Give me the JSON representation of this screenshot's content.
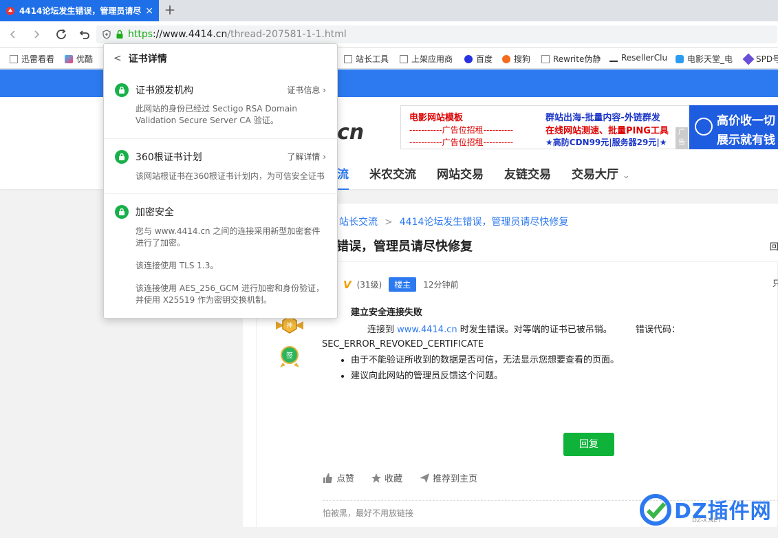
{
  "browser": {
    "tab_title": "4414论坛发生错误，管理员请尽",
    "tab_close": "×",
    "new_tab": "+",
    "url_scheme": "https",
    "url_host": "://www.4414.cn",
    "url_path": "/thread-207581-1-1.html",
    "accent_color": "#1e6fe8"
  },
  "bookmarks": [
    {
      "label": "迅雷看看",
      "icon": "page-icon"
    },
    {
      "label": "优酷",
      "icon": "youku-icon"
    },
    {
      "label": "站长工具",
      "icon": "folder-icon"
    },
    {
      "label": "上架应用商",
      "icon": "folder-icon"
    },
    {
      "label": "百度",
      "icon": "baidu-icon"
    },
    {
      "label": "搜狗",
      "icon": "sogou-icon"
    },
    {
      "label": "Rewrite伪静",
      "icon": "page-icon"
    },
    {
      "label": "ResellerClu",
      "icon": "reseller-icon"
    },
    {
      "label": "电影天堂_电",
      "icon": "shield-icon"
    },
    {
      "label": "SPD号",
      "icon": "spd-icon"
    }
  ],
  "header": {
    "logo_part": "cn",
    "ad_left": {
      "l1": "电影网站模板",
      "l2": "-----------广告位招租----------",
      "l3": "-----------广告位招租----------",
      "r1": "群站出海-批量内容-外链群发",
      "r2": "在线网站测速、批量PING工具",
      "r3": "★高防CDN99元|服务器29元|★"
    },
    "ad_tag": "广告",
    "ad_right": {
      "t1": "高价收一切",
      "t2": "展示就有钱"
    },
    "nav": [
      "流",
      "米农交流",
      "网站交易",
      "友链交易",
      "交易大厅"
    ],
    "nav_dropdown": "⌄"
  },
  "content": {
    "breadcrumb": [
      "站长交流",
      "4414论坛发生错误，管理员请尽快修复"
    ],
    "title": "错误，管理员请尽快修复",
    "title_right": "回",
    "meta": {
      "level_icon": "V",
      "level": "(31级)",
      "badge": "楼主",
      "time": "12分钟前",
      "right": "只"
    },
    "error": {
      "heading": "建立安全连接失败",
      "line_prefix": "连接到",
      "line_host": "www.4414.cn",
      "line_suffix": "时发生错误。对等端的证书已被吊销。",
      "code_label": "错误代码：",
      "code": "SEC_ERROR_REVOKED_CERTIFICATE",
      "bullets": [
        "由于不能验证所收到的数据是否可信，无法显示您想要查看的页面。",
        "建议向此网站的管理员反馈这个问题。"
      ]
    },
    "medal1_text": "神",
    "medal2_text": "签",
    "reply_button": "回复",
    "actions": [
      "点赞",
      "收藏",
      "推荐到主页"
    ],
    "signature": "怕被黑，最好不用放链接"
  },
  "popup": {
    "title": "证书详情",
    "sections": [
      {
        "title": "证书颁发机构",
        "link": "证书信息",
        "desc": "此网站的身份已经过 Sectigo RSA Domain Validation Secure Server CA 验证。"
      },
      {
        "title": "360根证书计划",
        "link": "了解详情",
        "desc": "该网站根证书在360根证书计划内，为可信安全证书"
      },
      {
        "title": "加密安全",
        "link": "",
        "desc": "您与 www.4414.cn 之间的连接采用新型加密套件进行了加密。",
        "desc2": "该连接使用 TLS 1.3。",
        "desc3": "该连接使用 AES_256_GCM 进行加密和身份验证，并使用 X25519 作为密钥交换机制。"
      }
    ]
  },
  "watermark": {
    "text": "DZ插件网",
    "sub": "DZ-X.NET"
  }
}
